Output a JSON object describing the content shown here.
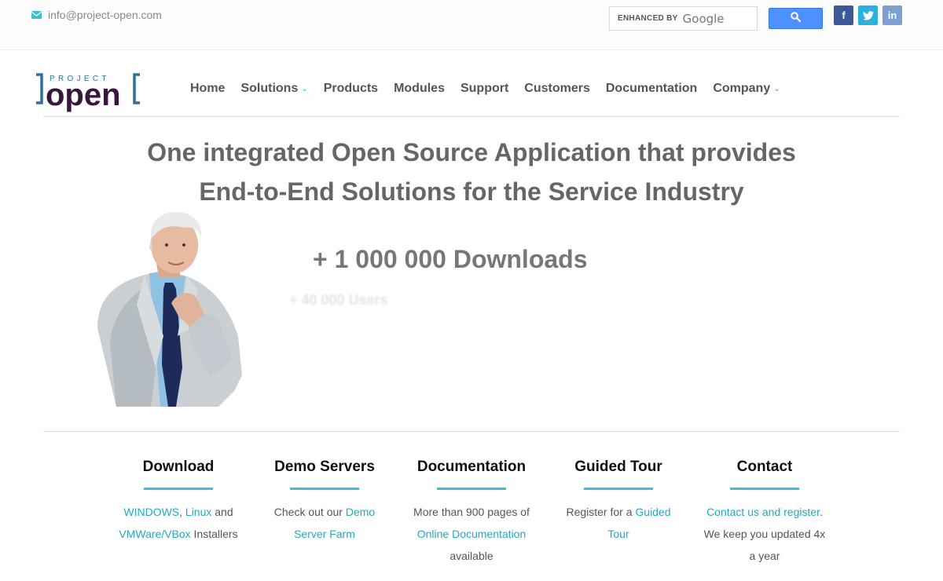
{
  "topbar": {
    "email": "info@project-open.com",
    "search": {
      "enhanced_by": "ENHANCED BY",
      "google": "Google",
      "button_icon": "search-icon"
    },
    "social": {
      "facebook": "f",
      "twitter": "twitter-icon",
      "linkedin": "in"
    }
  },
  "logo": {
    "project": "PROJECT",
    "open": "open"
  },
  "nav": [
    {
      "label": "Home"
    },
    {
      "label": "Solutions",
      "dropdown": true
    },
    {
      "label": "Products"
    },
    {
      "label": "Modules"
    },
    {
      "label": "Support"
    },
    {
      "label": "Customers"
    },
    {
      "label": "Documentation"
    },
    {
      "label": "Company",
      "dropdown": true
    }
  ],
  "hero": {
    "line1": "One integrated Open Source Application that provides",
    "line2": "End-to-End Solutions for the Service Industry",
    "downloads": "+ 1 000 000 Downloads",
    "users": "+ 40 000 Users"
  },
  "features": {
    "download": {
      "title": "Download",
      "windows": "WINDOWS",
      "sep": ", ",
      "linux": "Linux",
      "and": " and",
      "vmware": "VMWare/VBox",
      "installers": " Installers"
    },
    "demo": {
      "title": "Demo Servers",
      "pre": "Check out our ",
      "link": "Demo Server Farm"
    },
    "documentation": {
      "title": "Documentation",
      "pre": "More than 900 pages of ",
      "link": "Online Documentation",
      "post": " available"
    },
    "tour": {
      "title": "Guided Tour",
      "pre": "Register for a ",
      "link": "Guided Tour"
    },
    "contact": {
      "title": "Contact",
      "link": "Contact us and register",
      "dot": ".",
      "post": " We keep you updated 4x a year"
    }
  },
  "colors": {
    "accent": "#3ac0d0",
    "link": "#2aa7b8",
    "logo_blue": "#2d6f9f",
    "logo_purple": "#3a1540"
  }
}
